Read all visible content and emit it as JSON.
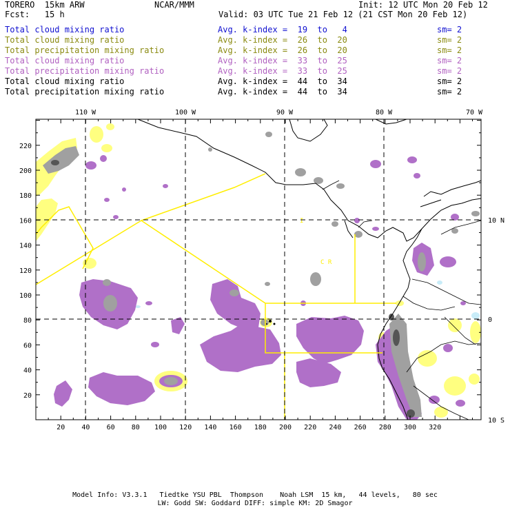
{
  "header": {
    "model": "TORERO  15km ARW",
    "center": "NCAR/MMM",
    "init": "Init: 12 UTC Mon 20 Feb 12",
    "fcst": "Fcst:   15 h",
    "valid": "Valid: 03 UTC Tue 21 Feb 12 (21 CST Mon 20 Feb 12)"
  },
  "legend": [
    {
      "field": "Total cloud mixing ratio",
      "kindex": "Avg. k-index =  19  to   4",
      "sm": "sm= 2",
      "color": "#1010d0"
    },
    {
      "field": "Total cloud mixing ratio",
      "kindex": "Avg. k-index =  26  to  20",
      "sm": "sm= 2",
      "color": "#8a8a10"
    },
    {
      "field": "Total precipitation mixing ratio",
      "kindex": "Avg. k-index =  26  to  20",
      "sm": "sm= 2",
      "color": "#8a8a10"
    },
    {
      "field": "Total cloud mixing ratio",
      "kindex": "Avg. k-index =  33  to  25",
      "sm": "sm= 2",
      "color": "#b060c0"
    },
    {
      "field": "Total precipitation mixing ratio",
      "kindex": "Avg. k-index =  33  to  25",
      "sm": "sm= 2",
      "color": "#b060c0"
    },
    {
      "field": "Total cloud mixing ratio",
      "kindex": "Avg. k-index =  44  to  34",
      "sm": "sm= 2",
      "color": "#000000"
    },
    {
      "field": "Total precipitation mixing ratio",
      "kindex": "Avg. k-index =  44  to  34",
      "sm": "sm= 2",
      "color": "#000000"
    }
  ],
  "map": {
    "lon_labels": [
      "110 W",
      "100 W",
      "90 W",
      "80 W",
      "70 W"
    ],
    "lat_labels": [
      "10 N",
      "0",
      "10 S"
    ],
    "x_ticks": [
      "20",
      "40",
      "60",
      "80",
      "100",
      "120",
      "140",
      "160",
      "180",
      "200",
      "220",
      "240",
      "260",
      "280",
      "300",
      "320"
    ],
    "y_ticks": [
      "20",
      "40",
      "60",
      "80",
      "100",
      "120",
      "140",
      "160",
      "180",
      "200",
      "220"
    ],
    "inset_labels": [
      "C  R",
      "I"
    ],
    "colors": {
      "purple": "#b070c8",
      "yellow": "#ffff80",
      "gray": "#a0a0a0",
      "dark_gray": "#606060",
      "light_blue": "#c8ecf8",
      "boundary_yellow": "#ffee00"
    }
  },
  "footer": {
    "line1": "Model Info: V3.3.1   Tiedtke YSU PBL  Thompson    Noah LSM  15 km,   44 levels,   80 sec",
    "line2": "LW: Godd SW: Goddard DIFF: simple KM: 2D Smagor"
  }
}
